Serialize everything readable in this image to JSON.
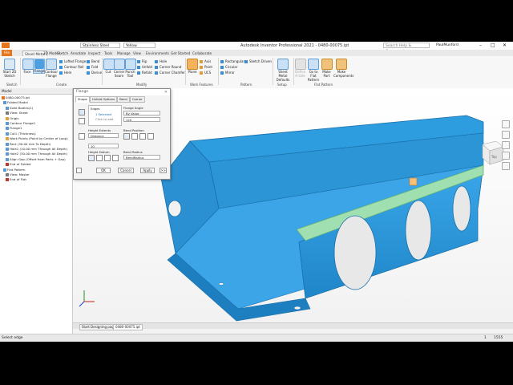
{
  "title": "Autodesk Inventor Professional 2021 - 0480-00075.ipt",
  "quick_access": {
    "material": "Stainless Steel",
    "appearance": "Yellow",
    "search_placeholder": "Search Help & Commands...",
    "user": "PaulMunford"
  },
  "tabs": [
    "File",
    "Sheet Metal",
    "3D Model",
    "Sketch",
    "Annotate",
    "Inspect",
    "Tools",
    "Manage",
    "View",
    "Environments",
    "Get Started",
    "Collaborate"
  ],
  "active_tab": "Sheet Metal",
  "ribbon": {
    "sketch": {
      "start_label": "Start 2D Sketch",
      "group": "Sketch"
    },
    "create": {
      "face": "Face",
      "flange": "Flange",
      "contour_flange": "Contour Flange",
      "lofted_flange": "Lofted Flange",
      "contour_roll": "Contour Roll",
      "hem": "Hem",
      "bend": "Bend",
      "fold": "Fold",
      "derive": "Derive",
      "group": "Create"
    },
    "modify": {
      "cut": "Cut",
      "corner_seam": "Corner Seam",
      "punch_tool": "Punch Tool",
      "rip": "Rip",
      "unfold": "Unfold",
      "refold": "Refold",
      "hole": "Hole",
      "corner_round": "Corner Round",
      "corner_chamfer": "Corner Chamfer",
      "group": "Modify"
    },
    "work_features": {
      "plane": "Plane",
      "axis": "Axis",
      "point": "Point",
      "ucs": "UCS",
      "group": "Work Features"
    },
    "pattern": {
      "rectangular": "Rectangular",
      "circular": "Circular",
      "mirror": "Mirror",
      "group": "Pattern"
    },
    "setup": {
      "sketch_driven": "Sketch Driven",
      "sheet_metal_defaults": "Sheet Metal Defaults",
      "group": "Setup"
    },
    "flat_pattern": {
      "define_ab": "Define A-Side",
      "go_to": "Go to Flat Pattern",
      "make_part": "Make Part",
      "make_components": "Make Components",
      "group": "Flat Pattern"
    }
  },
  "browser": {
    "tab": "Model",
    "items": [
      "0480-00075.ipt",
      "Folded Model",
      "Solid Bodies(1)",
      "View: Sheet",
      "Origin",
      "Contour Flange1",
      "Flange1",
      "Cut1 (Thickness)",
      "Work Points (Point by Center of Loop)",
      "Rect (30.00 mm To Depth)",
      "Hole1 (10.00 mm Through All Depth)",
      "Hole2 (30.00 mm Through All Depth)",
      "Align Gap (Offset from Parts + Gap)",
      "End of Folded",
      "Flat Pattern",
      "View: Master",
      "End of Flat"
    ]
  },
  "dialog": {
    "title": "Flange",
    "tabs": [
      "Shape",
      "Unfold Options",
      "Bend",
      "Corner"
    ],
    "edges_label": "Edges",
    "edges_value": "1 Selected",
    "click_to_add": "Click to add",
    "flange_angle_label": "Flange Angle",
    "flange_angle_mode": "By Value",
    "flange_angle_value": "120",
    "height_extents_label": "Height Extents",
    "height_extents_mode": "Distance",
    "height_value": "10",
    "height_datum_label": "Height Datum",
    "bend_position_label": "Bend Position",
    "bend_radius_label": "Bend Radius",
    "bend_radius_value": "BendRadius",
    "ok": "OK",
    "cancel": "Cancel",
    "apply": "Apply",
    "more": ">>"
  },
  "doc_tabs": [
    "Start Designing page.ipt",
    "0480-00075.ipt"
  ],
  "status": {
    "text": "Select edge",
    "count_a": "1",
    "count_b": "1555"
  },
  "colors": {
    "part": "#2e9de0",
    "file_tab": "#e5761d",
    "selected_edge": "#9fdfb0"
  }
}
